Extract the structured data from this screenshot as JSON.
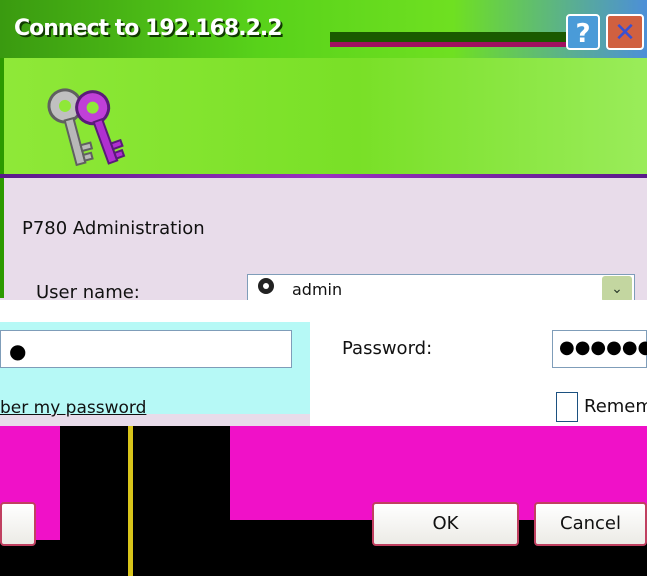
{
  "window": {
    "title": "Connect to 192.168.2.2",
    "help_glyph": "?",
    "close_glyph": "✕"
  },
  "dialog": {
    "heading": "P780 Administration",
    "username_label": "User name:",
    "username_value": "admin",
    "password_label": "Password:",
    "password_value_left": "●",
    "password_value_right": "●●●●●●●",
    "remember_label": "Remem",
    "remember_label_left": "ber my password",
    "remember_checked": false
  },
  "buttons": {
    "ok": "OK",
    "cancel": "Cancel"
  },
  "colors": {
    "titlebar": "#58d21a",
    "banner": "#79e027",
    "body_bg": "#e8dcea",
    "glitch_magenta": "#f011c8",
    "glitch_cyan": "#b6f9f6"
  },
  "icons": {
    "banner": "keys-icon",
    "user": "user-icon",
    "dropdown": "chevron-down-icon"
  }
}
